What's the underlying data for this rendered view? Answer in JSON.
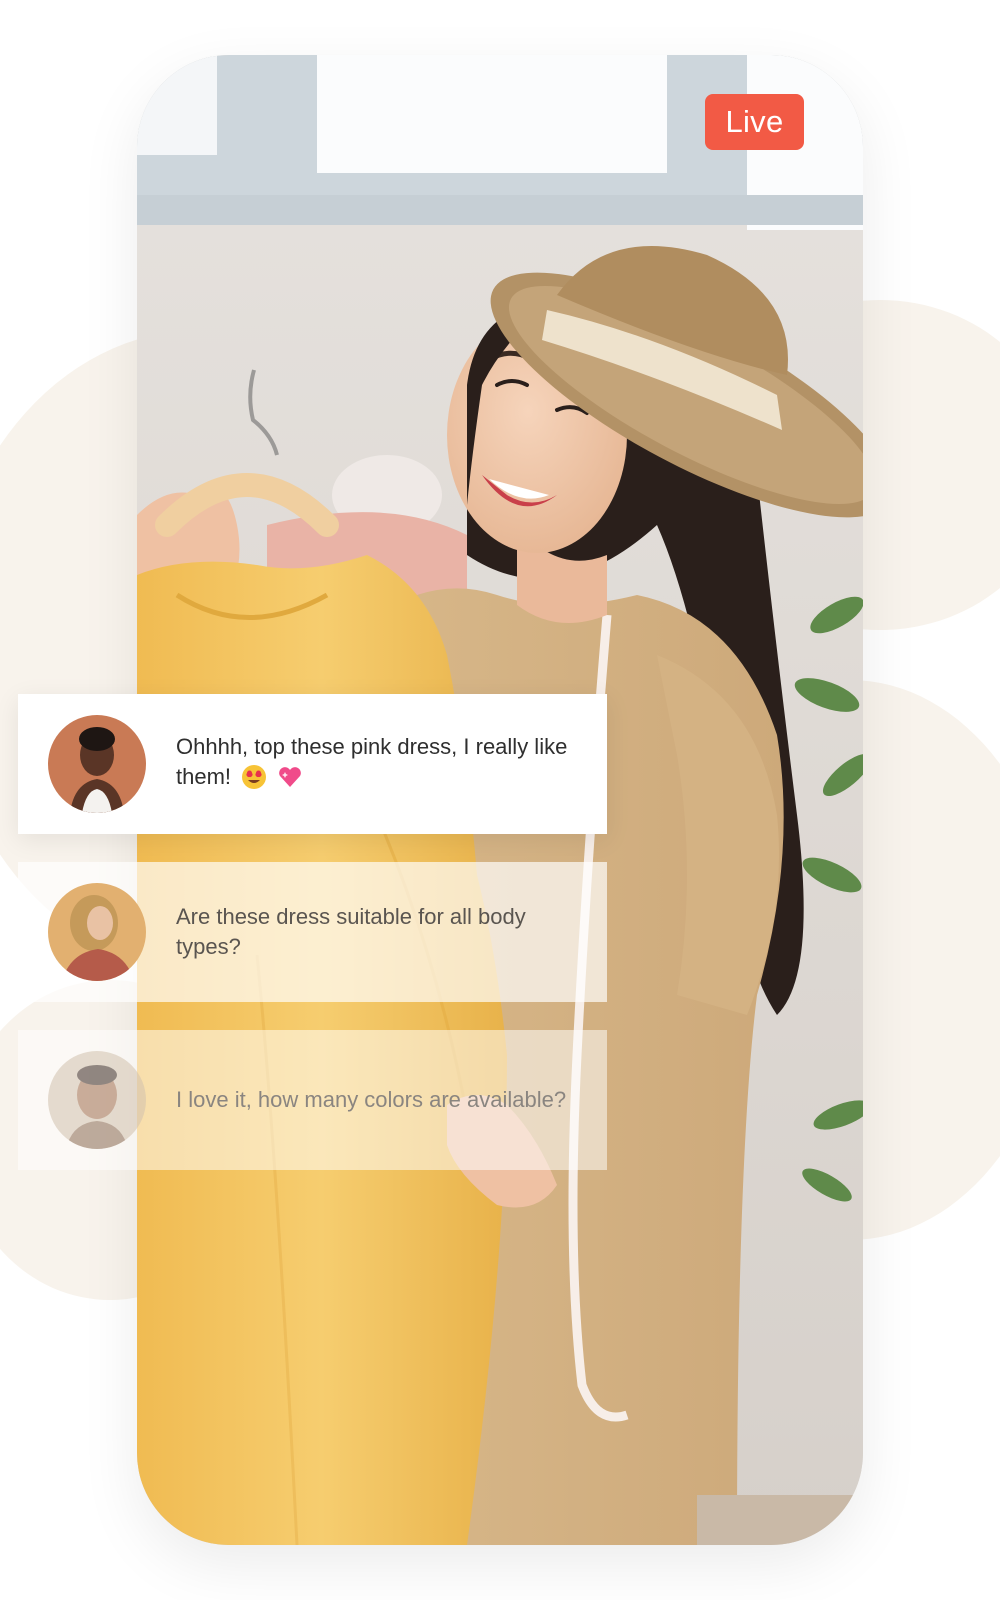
{
  "live_badge": {
    "label": "Live",
    "color": "#f25a45"
  },
  "comments": [
    {
      "avatar": "avatar-woman-white-tank",
      "text": "Ohhhh, top these pink dress, I really like them!",
      "emojis": [
        "heart-eyes-emoji",
        "sparkling-heart-emoji"
      ]
    },
    {
      "avatar": "avatar-woman-blonde-curly",
      "text": "Are these dress suitable for all body types?"
    },
    {
      "avatar": "avatar-woman-smiling",
      "text": "I love it, how many colors are available?"
    }
  ],
  "colors": {
    "cream_background": "#f8f3ec",
    "dress_yellow": "#f2c462",
    "shirt_beige": "#d9b98c",
    "card_white": "#ffffff"
  }
}
